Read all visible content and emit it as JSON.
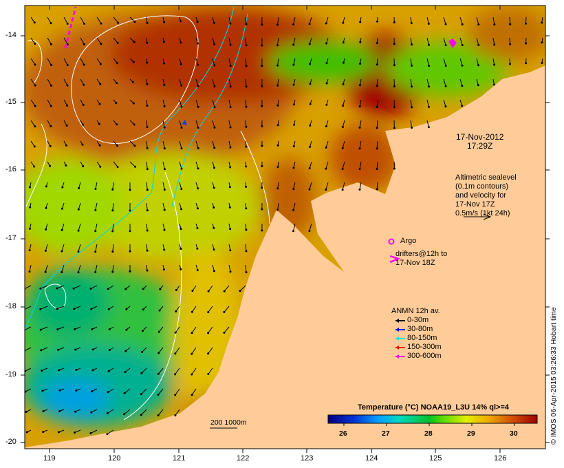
{
  "map": {
    "date": "17-Nov-2012",
    "time": "17:29Z",
    "altimetry_note": [
      "Altimetric sealevel",
      "(0.1m contours)",
      "and velocity for",
      "17-Nov 17Z",
      "0.5m/s (1kt 24h)"
    ],
    "argo_label": "Argo",
    "drifters_label": [
      "drifters@12h to",
      "17-Nov 18Z"
    ],
    "anmn": {
      "title": "ANMN 12h av.",
      "items": [
        {
          "label": "0-30m",
          "color": "#000000"
        },
        {
          "label": "30-80m",
          "color": "#0000ff"
        },
        {
          "label": "80-150m",
          "color": "#00e5ee"
        },
        {
          "label": "150-300m",
          "color": "#ff0000"
        },
        {
          "label": "300-600m",
          "color": "#ff00ff"
        }
      ]
    },
    "bathymetry_label": "200  1000m",
    "colorbar": {
      "title": "Temperature (°C) NOAA19_L3U 14% ql>=4",
      "ticks": [
        "26",
        "27",
        "28",
        "29",
        "30"
      ],
      "range": [
        25.6,
        30.5
      ]
    },
    "lon_ticks": [
      "119",
      "120",
      "121",
      "122",
      "123",
      "124",
      "125",
      "126"
    ],
    "lat_ticks": [
      "-14",
      "-15",
      "-16",
      "-17",
      "-18",
      "-19",
      "-20"
    ],
    "credit": "© IMOS 06-Apr-2015 03:26:33 Hobart time",
    "colors": {
      "land": "#ffcc99",
      "warm": "#a00000",
      "mid": "#d9a000",
      "cool": "#00b070"
    }
  }
}
